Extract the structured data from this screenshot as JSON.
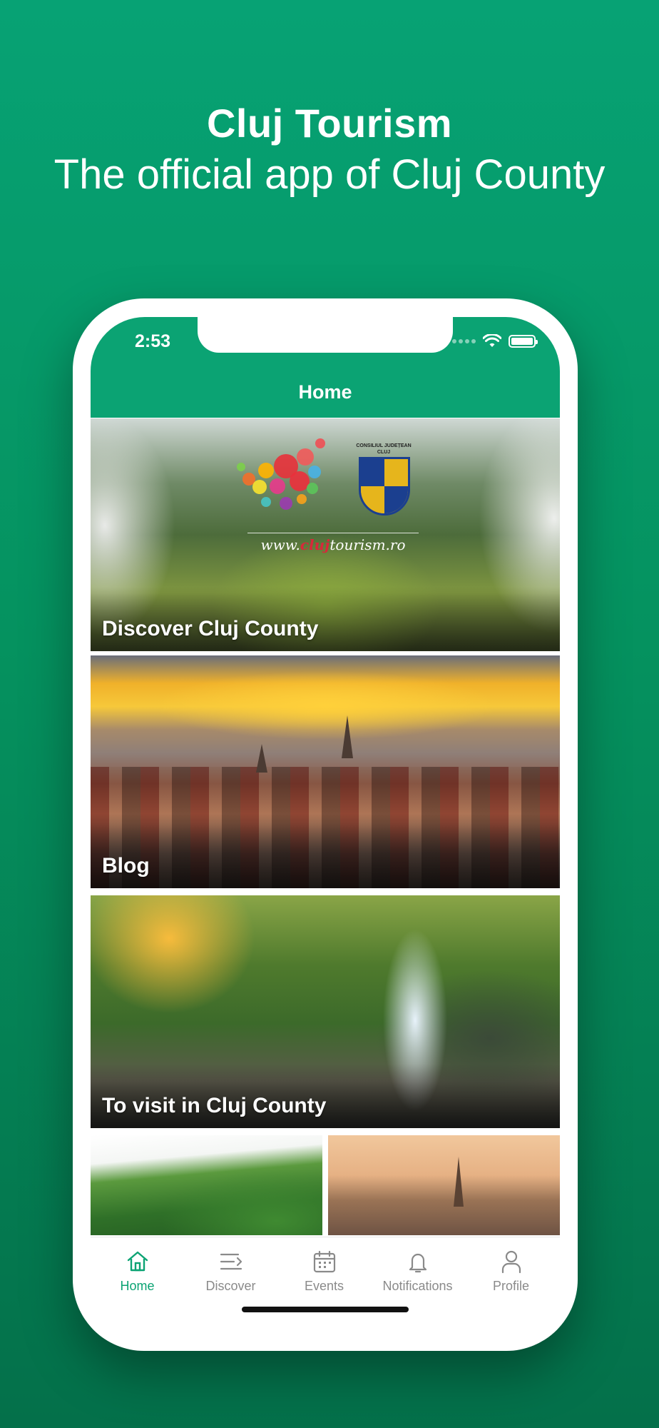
{
  "promo": {
    "title": "Cluj Tourism",
    "subtitle": "The official app of Cluj County"
  },
  "status_bar": {
    "time": "2:53"
  },
  "app_bar": {
    "title": "Home"
  },
  "cards": [
    {
      "label": "Discover Cluj County",
      "logo_text_prefix": "www.",
      "logo_text_highlight": "cluj",
      "logo_text_suffix": "tourism.ro",
      "crest_caption_line1": "CONSILIUL JUDEȚEAN",
      "crest_caption_line2": "CLUJ"
    },
    {
      "label": "Blog"
    },
    {
      "label": "To visit in Cluj County"
    }
  ],
  "tabs": [
    {
      "label": "Home",
      "icon": "home-icon",
      "active": true
    },
    {
      "label": "Discover",
      "icon": "discover-icon",
      "active": false
    },
    {
      "label": "Events",
      "icon": "calendar-icon",
      "active": false
    },
    {
      "label": "Notifications",
      "icon": "bell-icon",
      "active": false
    },
    {
      "label": "Profile",
      "icon": "user-icon",
      "active": false
    }
  ],
  "colors": {
    "brand_green": "#0ba373",
    "background_top": "#07a274",
    "background_bottom": "#04704a",
    "inactive_tab": "#8a8a8a"
  }
}
